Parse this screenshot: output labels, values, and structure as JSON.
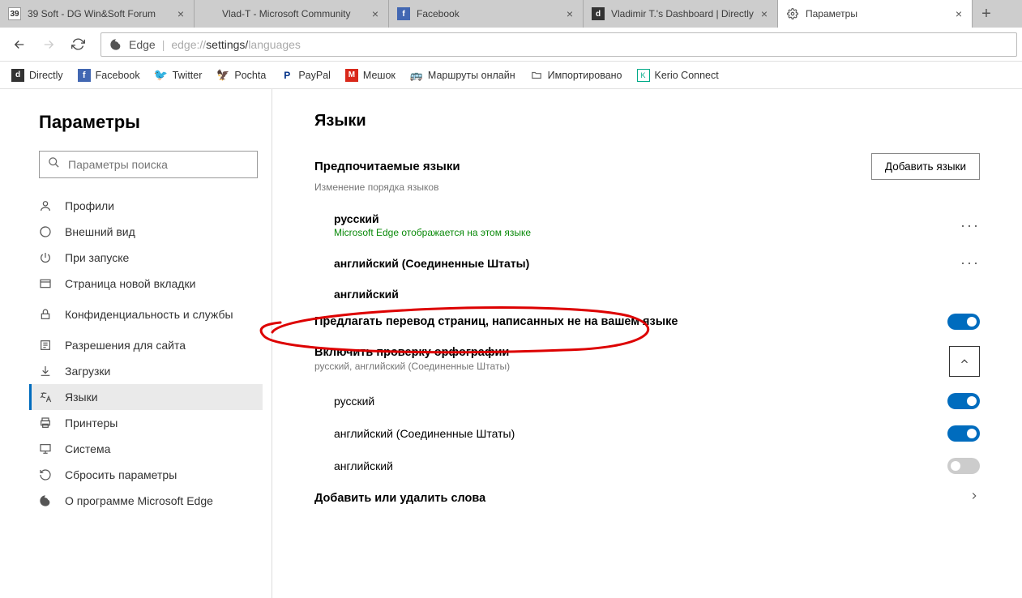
{
  "tabs": [
    {
      "title": "39 Soft - DG Win&Soft Forum",
      "favicon": "39"
    },
    {
      "title": "Vlad-T - Microsoft Community",
      "favicon": "ms"
    },
    {
      "title": "Facebook",
      "favicon": "fb"
    },
    {
      "title": "Vladimir T.'s Dashboard | Directly",
      "favicon": "d"
    },
    {
      "title": "Параметры",
      "favicon": "gear",
      "active": true
    }
  ],
  "address": {
    "prefix": "Edge",
    "url_dim1": "edge://",
    "url_mid": "settings/",
    "url_strong": "languages"
  },
  "bookmarks": [
    {
      "label": "Directly",
      "icon": "d"
    },
    {
      "label": "Facebook",
      "icon": "fb"
    },
    {
      "label": "Twitter",
      "icon": "tw"
    },
    {
      "label": "Pochta",
      "icon": "ru"
    },
    {
      "label": "PayPal",
      "icon": "pp"
    },
    {
      "label": "Мешок",
      "icon": "m"
    },
    {
      "label": "Маршруты онлайн",
      "icon": "map"
    },
    {
      "label": "Импортировано",
      "icon": "folder"
    },
    {
      "label": "Kerio Connect",
      "icon": "k"
    }
  ],
  "sidebar": {
    "heading": "Параметры",
    "search_placeholder": "Параметры поиска",
    "items": [
      {
        "label": "Профили"
      },
      {
        "label": "Внешний вид"
      },
      {
        "label": "При запуске"
      },
      {
        "label": "Страница новой вкладки"
      },
      {
        "label": "Конфиденциальность и службы"
      },
      {
        "label": "Разрешения для сайта"
      },
      {
        "label": "Загрузки"
      },
      {
        "label": "Языки",
        "active": true
      },
      {
        "label": "Принтеры"
      },
      {
        "label": "Система"
      },
      {
        "label": "Сбросить параметры"
      },
      {
        "label": "О программе Microsoft Edge"
      }
    ]
  },
  "main": {
    "heading": "Языки",
    "preferred_title": "Предпочитаемые языки",
    "preferred_sub": "Изменение порядка языков",
    "add_button": "Добавить языки",
    "languages": [
      {
        "name": "русский",
        "note": "Microsoft Edge отображается на этом языке"
      },
      {
        "name": "английский (Соединенные Штаты)"
      },
      {
        "name": "английский"
      }
    ],
    "translate_label": "Предлагать перевод страниц, написанных не на вашем языке",
    "translate_on": true,
    "spell_title": "Включить проверку орфографии",
    "spell_sub": "русский, английский (Соединенные Штаты)",
    "spell_items": [
      {
        "name": "русский",
        "on": true
      },
      {
        "name": "английский (Соединенные Штаты)",
        "on": true
      },
      {
        "name": "английский",
        "on": false
      }
    ],
    "dict_label": "Добавить или удалить слова"
  }
}
